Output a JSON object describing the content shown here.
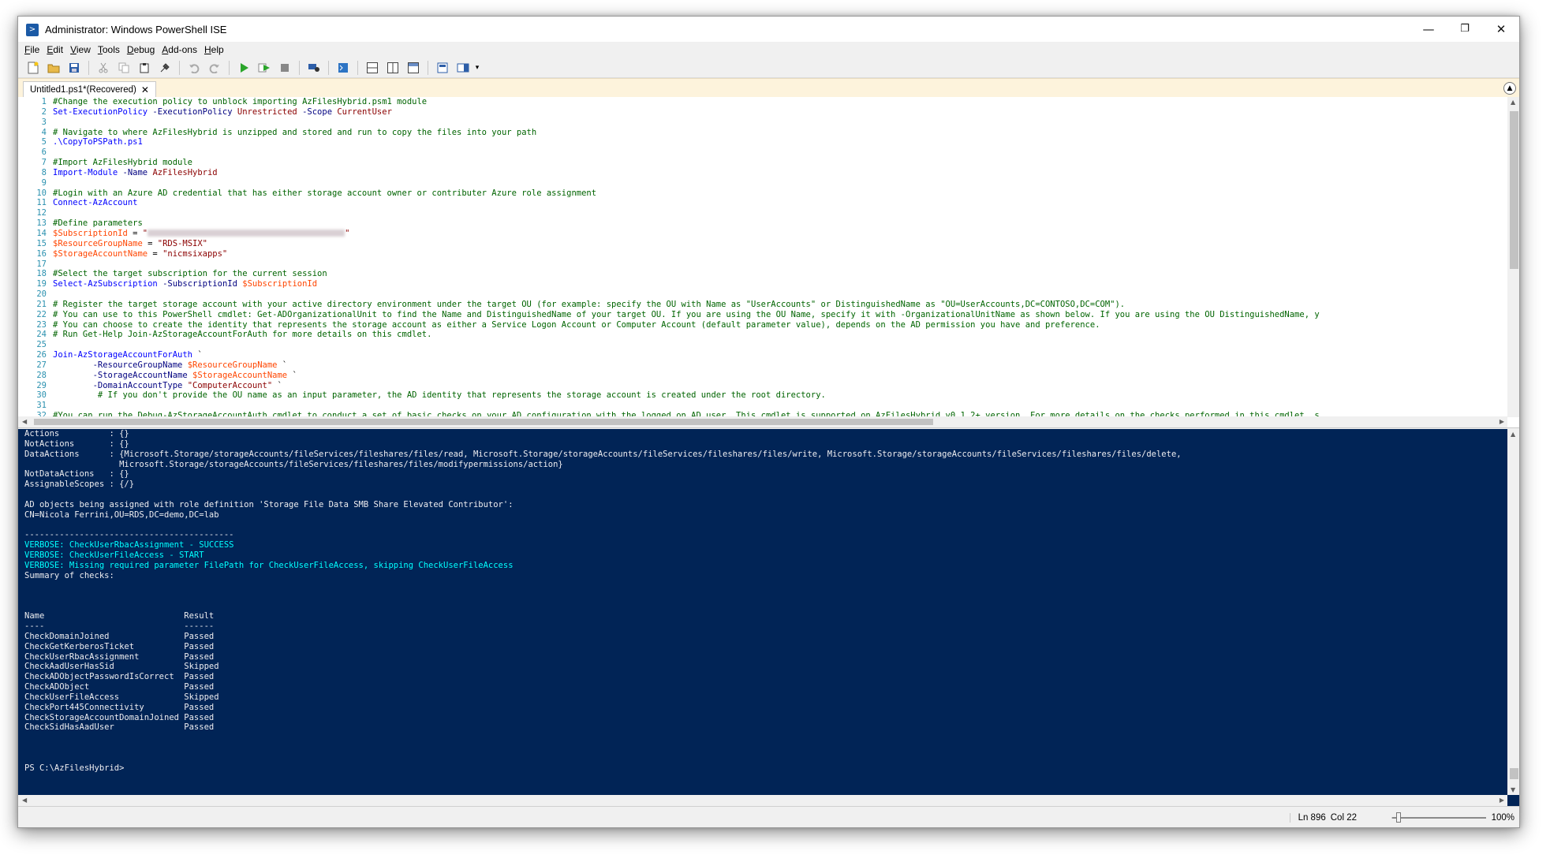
{
  "window": {
    "title": "Administrator: Windows PowerShell ISE",
    "controls": {
      "minimize": "—",
      "restore": "❐",
      "close": "✕"
    }
  },
  "menu": [
    "File",
    "Edit",
    "View",
    "Tools",
    "Debug",
    "Add-ons",
    "Help"
  ],
  "toolbar": [
    "new-icon",
    "open-icon",
    "save-icon",
    "cut-icon",
    "copy-icon",
    "paste-icon",
    "clear-icon",
    "undo-icon",
    "redo-icon",
    "run-icon",
    "run-selection-icon",
    "stop-icon",
    "remote-icon",
    "console-icon",
    "layout-top-icon",
    "layout-right-icon",
    "layout-max-icon",
    "show-commands-icon",
    "command-addon-icon"
  ],
  "tab": {
    "label": "Untitled1.ps1*(Recovered)",
    "close": "✕"
  },
  "script": {
    "line_numbers": [
      "1",
      "2",
      "3",
      "4",
      "5",
      "6",
      "7",
      "8",
      "9",
      "10",
      "11",
      "12",
      "13",
      "14",
      "15",
      "16",
      "17",
      "18",
      "19",
      "20",
      "21",
      "22",
      "23",
      "24",
      "25",
      "26",
      "27",
      "28",
      "29",
      "30",
      "31",
      "32"
    ],
    "lines": [
      [
        {
          "t": "#Change the execution policy to unblock importing AzFilesHybrid.psm1 module",
          "c": "comment"
        }
      ],
      [
        {
          "t": "Set-ExecutionPolicy",
          "c": "cmd"
        },
        {
          "t": " -ExecutionPolicy",
          "c": "param"
        },
        {
          "t": " Unrestricted",
          "c": "str"
        },
        {
          "t": " -Scope",
          "c": "param"
        },
        {
          "t": " CurrentUser",
          "c": "str"
        }
      ],
      [],
      [
        {
          "t": "# Navigate to where AzFilesHybrid is unzipped and stored and run to copy the files into your path",
          "c": "comment"
        }
      ],
      [
        {
          "t": ".\\CopyToPSPath.ps1",
          "c": "cmd"
        }
      ],
      [],
      [
        {
          "t": "#Import AzFilesHybrid module",
          "c": "comment"
        }
      ],
      [
        {
          "t": "Import-Module",
          "c": "cmd"
        },
        {
          "t": " -Name",
          "c": "param"
        },
        {
          "t": " AzFilesHybrid",
          "c": "str"
        }
      ],
      [],
      [
        {
          "t": "#Login with an Azure AD credential that has either storage account owner or contributer Azure role assignment",
          "c": "comment"
        }
      ],
      [
        {
          "t": "Connect-AzAccount",
          "c": "cmd"
        }
      ],
      [],
      [
        {
          "t": "#Define parameters",
          "c": "comment"
        }
      ],
      [
        {
          "t": "$SubscriptionId",
          "c": "var"
        },
        {
          "t": " = ",
          "c": "plain"
        },
        {
          "t": "\"",
          "c": "str"
        },
        {
          "redacted": true
        },
        {
          "t": "\"",
          "c": "str"
        }
      ],
      [
        {
          "t": "$ResourceGroupName",
          "c": "var"
        },
        {
          "t": " = ",
          "c": "plain"
        },
        {
          "t": "\"RDS-MSIX\"",
          "c": "str"
        }
      ],
      [
        {
          "t": "$StorageAccountName",
          "c": "var"
        },
        {
          "t": " = ",
          "c": "plain"
        },
        {
          "t": "\"nicmsixapps\"",
          "c": "str"
        }
      ],
      [],
      [
        {
          "t": "#Select the target subscription for the current session",
          "c": "comment"
        }
      ],
      [
        {
          "t": "Select-AzSubscription",
          "c": "cmd"
        },
        {
          "t": " -SubscriptionId",
          "c": "param"
        },
        {
          "t": " $SubscriptionId",
          "c": "var"
        }
      ],
      [],
      [
        {
          "t": "# Register the target storage account with your active directory environment under the target OU (for example: specify the OU with Name as \"UserAccounts\" or DistinguishedName as \"OU=UserAccounts,DC=CONTOSO,DC=COM\").",
          "c": "comment"
        }
      ],
      [
        {
          "t": "# You can use to this PowerShell cmdlet: Get-ADOrganizationalUnit to find the Name and DistinguishedName of your target OU. If you are using the OU Name, specify it with -OrganizationalUnitName as shown below. If you are using the OU DistinguishedName, y",
          "c": "comment"
        }
      ],
      [
        {
          "t": "# You can choose to create the identity that represents the storage account as either a Service Logon Account or Computer Account (default parameter value), depends on the AD permission you have and preference.",
          "c": "comment"
        }
      ],
      [
        {
          "t": "# Run Get-Help Join-AzStorageAccountForAuth for more details on this cmdlet.",
          "c": "comment"
        }
      ],
      [],
      [
        {
          "t": "Join-AzStorageAccountForAuth",
          "c": "cmd"
        },
        {
          "t": " `",
          "c": "plain"
        }
      ],
      [
        {
          "t": "        -ResourceGroupName",
          "c": "param"
        },
        {
          "t": " $ResourceGroupName",
          "c": "var"
        },
        {
          "t": " `",
          "c": "plain"
        }
      ],
      [
        {
          "t": "        -StorageAccountName",
          "c": "param"
        },
        {
          "t": " $StorageAccountName",
          "c": "var"
        },
        {
          "t": " `",
          "c": "plain"
        }
      ],
      [
        {
          "t": "        -DomainAccountType",
          "c": "param"
        },
        {
          "t": " \"ComputerAccount\"",
          "c": "str"
        },
        {
          "t": " `",
          "c": "plain"
        }
      ],
      [
        {
          "t": "         # If you don't provide the OU name as an input parameter, the AD identity that represents the storage account is created under the root directory.",
          "c": "comment"
        }
      ],
      [],
      [
        {
          "t": "#You can run the Debug-AzStorageAccountAuth cmdlet to conduct a set of basic checks on your AD configuration with the logged on AD user. This cmdlet is supported on AzFilesHybrid v0.1.2+ version. For more details on the checks performed in this cmdlet, s",
          "c": "comment"
        }
      ]
    ]
  },
  "console": {
    "lines": [
      {
        "t": "Actions          : {}"
      },
      {
        "t": "NotActions       : {}"
      },
      {
        "t": "DataActions      : {Microsoft.Storage/storageAccounts/fileServices/fileshares/files/read, Microsoft.Storage/storageAccounts/fileServices/fileshares/files/write, Microsoft.Storage/storageAccounts/fileServices/fileshares/files/delete,"
      },
      {
        "t": "                   Microsoft.Storage/storageAccounts/fileServices/fileshares/files/modifypermissions/action}"
      },
      {
        "t": "NotDataActions   : {}"
      },
      {
        "t": "AssignableScopes : {/}"
      },
      {
        "t": ""
      },
      {
        "t": "AD objects being assigned with role definition 'Storage File Data SMB Share Elevated Contributor':"
      },
      {
        "t": "CN=Nicola Ferrini,OU=RDS,DC=demo,DC=lab"
      },
      {
        "t": ""
      },
      {
        "t": "------------------------------------------"
      },
      {
        "t": "VERBOSE: CheckUserRbacAssignment - SUCCESS",
        "v": true
      },
      {
        "t": "VERBOSE: CheckUserFileAccess - START",
        "v": true
      },
      {
        "t": "VERBOSE: Missing required parameter FilePath for CheckUserFileAccess, skipping CheckUserFileAccess",
        "v": true
      },
      {
        "t": "Summary of checks:"
      },
      {
        "t": ""
      },
      {
        "t": ""
      },
      {
        "t": ""
      },
      {
        "t": "Name                            Result"
      },
      {
        "t": "----                            ------"
      },
      {
        "t": "CheckDomainJoined               Passed"
      },
      {
        "t": "CheckGetKerberosTicket          Passed"
      },
      {
        "t": "CheckUserRbacAssignment         Passed"
      },
      {
        "t": "CheckAadUserHasSid              Skipped"
      },
      {
        "t": "CheckADObjectPasswordIsCorrect  Passed"
      },
      {
        "t": "CheckADObject                   Passed"
      },
      {
        "t": "CheckUserFileAccess             Skipped"
      },
      {
        "t": "CheckPort445Connectivity        Passed"
      },
      {
        "t": "CheckStorageAccountDomainJoined Passed"
      },
      {
        "t": "CheckSidHasAadUser              Passed"
      },
      {
        "t": ""
      },
      {
        "t": ""
      },
      {
        "t": ""
      },
      {
        "t": "PS C:\\AzFilesHybrid>"
      }
    ]
  },
  "status": {
    "line": "Ln 896",
    "col": "Col 22",
    "zoom": "100%",
    "zoom_level_percent": 100
  },
  "colors": {
    "console_bg": "#012456",
    "console_fg": "#eeedf0",
    "verbose": "#00ffff",
    "comment": "#006400",
    "command": "#0000ff",
    "parameter": "#000080",
    "variable": "#ff4500",
    "string": "#8b0000",
    "tab_strip": "#fdf3dc"
  }
}
